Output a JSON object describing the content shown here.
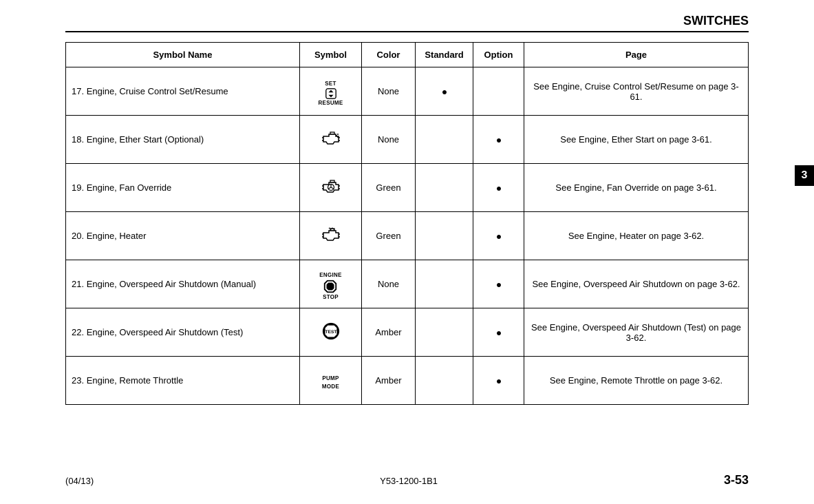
{
  "header": {
    "title": "SWITCHES"
  },
  "chapter_tab": "3",
  "footer": {
    "left": "(04/13)",
    "center": "Y53-1200-1B1",
    "right": "3-53"
  },
  "table": {
    "headers": {
      "symbol_name": "Symbol Name",
      "symbol": "Symbol",
      "color": "Color",
      "standard": "Standard",
      "option": "Option",
      "page": "Page"
    },
    "rows": [
      {
        "num": "17.",
        "name": "Engine, Cruise Control Set/Resume",
        "icon": "cruise-set-resume-icon",
        "icon_top_label": "SET",
        "icon_bottom_label": "RESUME",
        "color": "None",
        "standard": true,
        "option": false,
        "page": "See Engine, Cruise Control Set/Resume on page 3-61."
      },
      {
        "num": "18.",
        "name": "Engine, Ether Start (Optional)",
        "icon": "ether-start-icon",
        "icon_top_label": "",
        "icon_bottom_label": "",
        "color": "None",
        "standard": false,
        "option": true,
        "page": "See Engine, Ether Start on page 3-61."
      },
      {
        "num": "19.",
        "name": "Engine, Fan Override",
        "icon": "fan-override-icon",
        "icon_top_label": "",
        "icon_bottom_label": "",
        "color": "Green",
        "standard": false,
        "option": true,
        "page": "See Engine, Fan Override on page 3-61."
      },
      {
        "num": "20.",
        "name": "Engine, Heater",
        "icon": "engine-heater-icon",
        "icon_top_label": "",
        "icon_bottom_label": "",
        "color": "Green",
        "standard": false,
        "option": true,
        "page": "See Engine, Heater on page 3-62."
      },
      {
        "num": "21.",
        "name": "Engine, Overspeed Air Shutdown (Manual)",
        "icon": "overspeed-shutdown-icon",
        "icon_top_label": "ENGINE",
        "icon_bottom_label": "STOP",
        "color": "None",
        "standard": false,
        "option": true,
        "page": "See Engine, Overspeed Air Shutdown on page 3-62."
      },
      {
        "num": "22.",
        "name": "Engine, Overspeed Air Shutdown (Test)",
        "icon": "overspeed-shutdown-test-icon",
        "icon_top_label": "",
        "icon_bottom_label": "",
        "color": "Amber",
        "standard": false,
        "option": true,
        "page": "See Engine, Overspeed Air Shutdown (Test) on page 3-62."
      },
      {
        "num": "23.",
        "name": "Engine, Remote Throttle",
        "icon": "remote-throttle-icon",
        "icon_top_label": "PUMP",
        "icon_bottom_label": "MODE",
        "color": "Amber",
        "standard": false,
        "option": true,
        "page": "See Engine, Remote Throttle on page 3-62."
      }
    ]
  }
}
